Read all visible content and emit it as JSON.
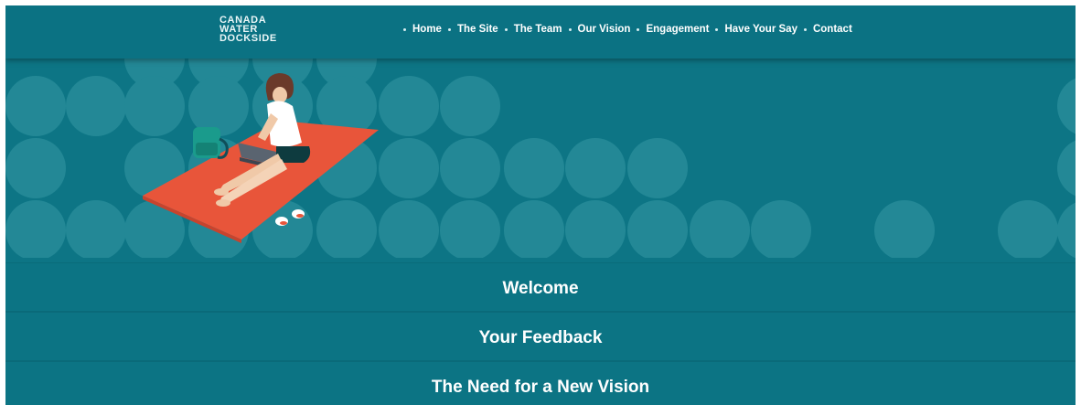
{
  "logo": {
    "lines": [
      "CANADA",
      "WATER",
      "DOCKSIDE"
    ]
  },
  "nav": {
    "items": [
      {
        "label": "Home"
      },
      {
        "label": "The Site"
      },
      {
        "label": "The Team"
      },
      {
        "label": "Our Vision"
      },
      {
        "label": "Engagement"
      },
      {
        "label": "Have Your Say"
      },
      {
        "label": "Contact"
      }
    ]
  },
  "hero": {
    "illustration": "person-on-blanket-with-laptop",
    "background_pattern": "circle-dots"
  },
  "sections": [
    {
      "title": "Welcome"
    },
    {
      "title": "Your Feedback"
    },
    {
      "title": "The Need for a New Vision"
    }
  ],
  "colors": {
    "background": "#0d7585",
    "circle": "#2b8f9c",
    "blanket": "#e8553a",
    "text": "#ffffff"
  }
}
